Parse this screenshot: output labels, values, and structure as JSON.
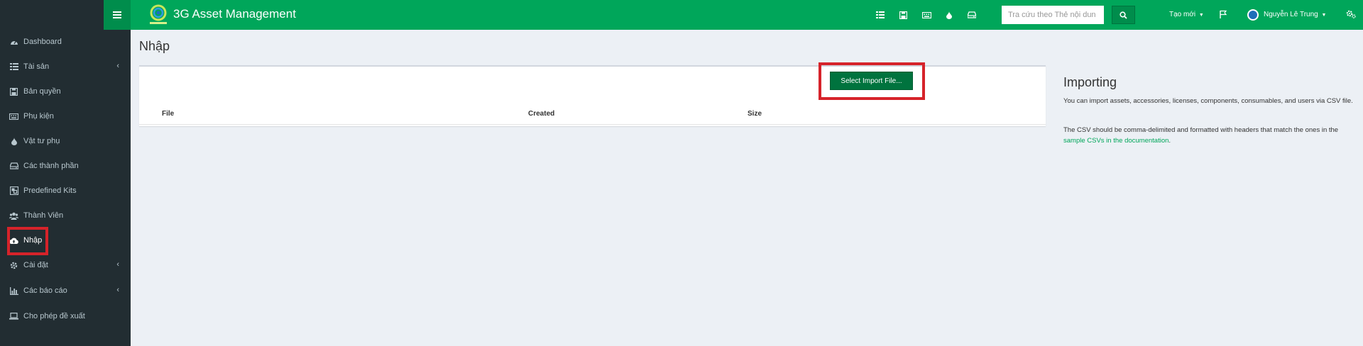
{
  "header": {
    "brand_title": "3G Asset Management",
    "search_placeholder": "Tra cứu theo Thẻ nội dun",
    "create_new": "Tạo mới",
    "user_name": "Nguyễn Lê Trung",
    "accent": "#00a65a"
  },
  "sidebar": {
    "items": [
      {
        "label": "Dashboard",
        "icon": "dashboard-icon"
      },
      {
        "label": "Tài sản",
        "icon": "barcode-icon",
        "has_caret": true
      },
      {
        "label": "Bản quyền",
        "icon": "floppy-icon"
      },
      {
        "label": "Phụ kiện",
        "icon": "keyboard-icon"
      },
      {
        "label": "Vật tư phụ",
        "icon": "tint-icon"
      },
      {
        "label": "Các thành phần",
        "icon": "hdd-icon"
      },
      {
        "label": "Predefined Kits",
        "icon": "object-group-icon"
      },
      {
        "label": "Thành Viên",
        "icon": "users-icon"
      },
      {
        "label": "Nhập",
        "icon": "cloud-upload-icon",
        "active": true
      },
      {
        "label": "Cài đặt",
        "icon": "cog-icon",
        "has_caret": true
      },
      {
        "label": "Các báo cáo",
        "icon": "bar-chart-icon",
        "has_caret": true
      },
      {
        "label": "Cho phép đề xuất",
        "icon": "laptop-icon"
      }
    ]
  },
  "main": {
    "page_title": "Nhập",
    "import_button": "Select Import File...",
    "table_headers": [
      "File",
      "Created",
      "Size"
    ],
    "importing": {
      "title": "Importing",
      "para1": "You can import assets, accessories, licenses, components, consumables, and users via CSV file.",
      "para2_prefix": "The CSV should be comma-delimited and formatted with headers that match the ones in the",
      "para2_link": "sample CSVs in the documentation",
      "para2_suffix": "."
    }
  }
}
